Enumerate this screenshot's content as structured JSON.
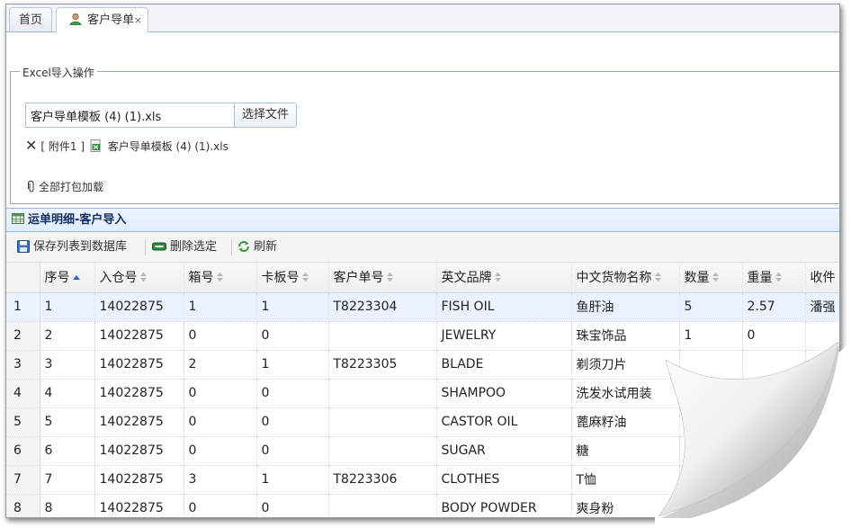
{
  "tabs": [
    {
      "label": "首页",
      "active": false
    },
    {
      "label": "客户导单",
      "active": true,
      "close": "×"
    }
  ],
  "excel": {
    "legend": "Excel导入操作",
    "file_value": "客户导单模板 (4) (1).xls",
    "choose_button": "选择文件",
    "attachment_prefix": "[ 附件1 ]",
    "attachment_name": "客户导单模板 (4) (1).xls",
    "pack_all": "全部打包加载"
  },
  "panel": {
    "title": "运单明细-客户导入"
  },
  "toolbar": {
    "save": "保存列表到数据库",
    "delete": "删除选定",
    "refresh": "刷新"
  },
  "table": {
    "columns": [
      "序号",
      "入仓号",
      "箱号",
      "卡板号",
      "客户单号",
      "英文品牌",
      "中文货物名称",
      "数量",
      "重量",
      "收件"
    ],
    "rows": [
      {
        "n": "1",
        "c": [
          "1",
          "14022875",
          "1",
          "1",
          "T8223304",
          "FISH OIL",
          "鱼肝油",
          "5",
          "2.57",
          "潘强"
        ]
      },
      {
        "n": "2",
        "c": [
          "2",
          "14022875",
          "0",
          "0",
          "",
          "JEWELRY",
          "珠宝饰品",
          "1",
          "0",
          ""
        ]
      },
      {
        "n": "3",
        "c": [
          "3",
          "14022875",
          "2",
          "1",
          "T8223305",
          "BLADE",
          "剃须刀片",
          "",
          "",
          ""
        ]
      },
      {
        "n": "4",
        "c": [
          "4",
          "14022875",
          "0",
          "0",
          "",
          "SHAMPOO",
          "洗发水试用装",
          "",
          "",
          ""
        ]
      },
      {
        "n": "5",
        "c": [
          "5",
          "14022875",
          "0",
          "0",
          "",
          "CASTOR OIL",
          "蓖麻籽油",
          "",
          "",
          ""
        ]
      },
      {
        "n": "6",
        "c": [
          "6",
          "14022875",
          "0",
          "0",
          "",
          "SUGAR",
          "糖",
          "",
          "",
          ""
        ]
      },
      {
        "n": "7",
        "c": [
          "7",
          "14022875",
          "3",
          "1",
          "T8223306",
          "CLOTHES",
          "T恤",
          "",
          "",
          ""
        ]
      },
      {
        "n": "8",
        "c": [
          "8",
          "14022875",
          "0",
          "0",
          "",
          "BODY POWDER",
          "爽身粉",
          "",
          "",
          ""
        ]
      }
    ]
  },
  "colors": {
    "accent": "#95b8e7",
    "header_text": "#0e2d5f",
    "selected_row": "#eaf2ff"
  }
}
